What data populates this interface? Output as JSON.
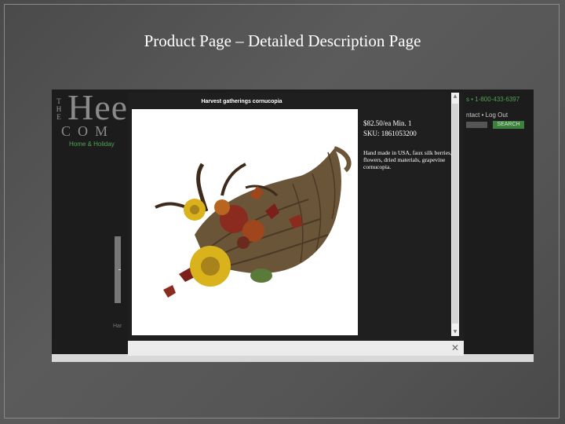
{
  "slide": {
    "title": "Product Page – Detailed Description Page"
  },
  "site": {
    "logo_the": [
      "T",
      "H",
      "E"
    ],
    "logo_main": "Hee",
    "logo_sub": "COM",
    "logo_tagline": "Home & Holiday",
    "phone": "s • 1-800-433-6397",
    "links": "ntact  •  Log Out",
    "search_button": "SEARCH",
    "side_text": "Har"
  },
  "modal": {
    "title": "Harvest gatherings cornucopia",
    "price": "$82.50/ea Min. 1",
    "sku": "SKU: 1861053200",
    "description": "Hand made in USA, faux silk berries, flowers, dried materials, grapevine cornucopia.",
    "close_label": "✕",
    "image_alt": "cornucopia-photo"
  },
  "colors": {
    "accent_green": "#4fa34f",
    "site_background": "#1c1c1c",
    "slide_background": "#555555"
  }
}
